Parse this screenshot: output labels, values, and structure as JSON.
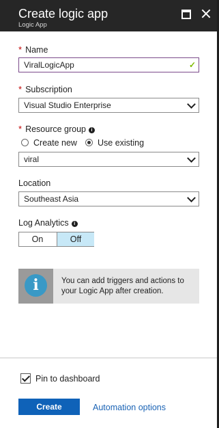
{
  "header": {
    "title": "Create logic app",
    "subtitle": "Logic App"
  },
  "form": {
    "name": {
      "label": "Name",
      "required": "*",
      "value": "ViralLogicApp",
      "valid_mark": "✓"
    },
    "subscription": {
      "label": "Subscription",
      "required": "*",
      "value": "Visual Studio Enterprise"
    },
    "resource_group": {
      "label": "Resource group",
      "required": "*",
      "info": "i",
      "options": [
        "Create new",
        "Use existing"
      ],
      "selected": "Use existing",
      "value": "viral"
    },
    "location": {
      "label": "Location",
      "value": "Southeast Asia"
    },
    "log_analytics": {
      "label": "Log Analytics",
      "info": "i",
      "on_label": "On",
      "off_label": "Off",
      "selected": "Off"
    }
  },
  "info_box": {
    "icon_glyph": "i",
    "text": "You can add triggers and actions to your Logic App after creation."
  },
  "footer": {
    "pin_label": "Pin to dashboard",
    "pin_checked": true,
    "create_label": "Create",
    "automation_label": "Automation options"
  },
  "colors": {
    "header_bg": "#262626",
    "primary_button": "#0f62b8",
    "link": "#1a63b5",
    "required": "#c00000",
    "toggle_selected": "#c7e8f7",
    "info_icon": "#3999c6",
    "valid_check": "#7fba00"
  }
}
